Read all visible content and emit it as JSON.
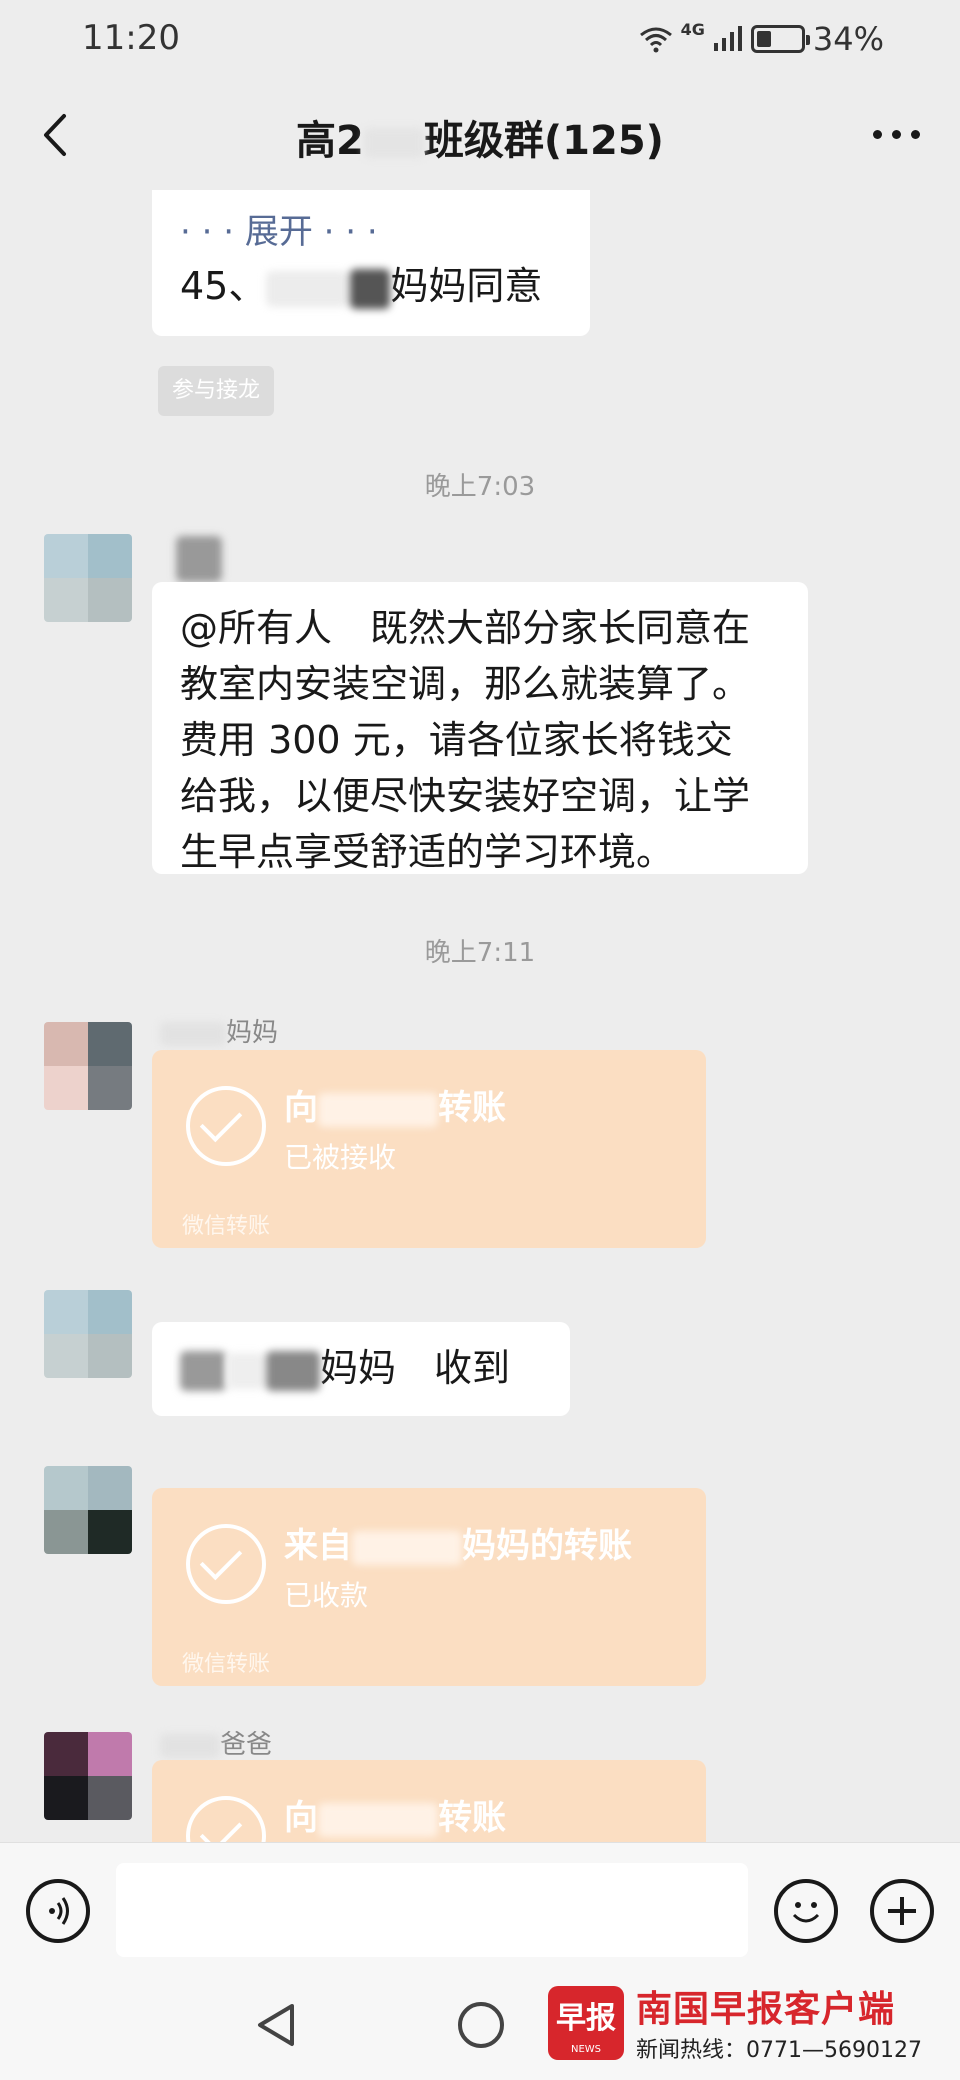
{
  "status_bar": {
    "time": "11:20",
    "network": "4G",
    "battery": "34%",
    "battery_level": 0.34
  },
  "header": {
    "title_prefix": "高2",
    "title_suffix": "班级群(125)"
  },
  "messages": {
    "jielong": {
      "expand_text": "· · · 展开 · · ·",
      "line_prefix": "45、",
      "line_suffix": "妈妈同意",
      "tag": "参与接龙"
    },
    "time1": "晚上7:03",
    "announcement": {
      "lines": [
        "@所有人　既然大部分家长同意在",
        "教室内安装空调，那么就装算了。",
        "费用 300 元，请各位家长将钱交",
        "给我，以便尽快安装好空调，让学",
        "生早点享受舒适的学习环境。"
      ]
    },
    "time2": "晚上7:11",
    "transfer1": {
      "sender_suffix": "妈妈",
      "title_prefix": "向",
      "title_suffix": "转账",
      "status": "已被接收",
      "footer": "微信转账"
    },
    "reply": {
      "text_suffix": "妈妈　收到"
    },
    "transfer2": {
      "title_prefix": "来自",
      "title_suffix": "妈妈的转账",
      "status": "已收款",
      "footer": "微信转账"
    },
    "transfer3": {
      "sender_suffix": "爸爸",
      "title_prefix": "向",
      "title_suffix": "转账"
    }
  },
  "watermark": {
    "logo": "早报",
    "logo_sub": "NEWS",
    "name": "南国早报客户端",
    "hotline": "新闻热线：0771—5690127"
  },
  "icons": [
    "back-arrow-icon",
    "more-dots-icon",
    "voice-icon",
    "emoji-icon",
    "plus-icon",
    "nav-back-icon",
    "nav-home-icon"
  ],
  "colors": {
    "background": "#ededed",
    "bubble": "#ffffff",
    "transfer": "#fbdec2",
    "link": "#576b95",
    "brand_red": "#d7262c"
  }
}
